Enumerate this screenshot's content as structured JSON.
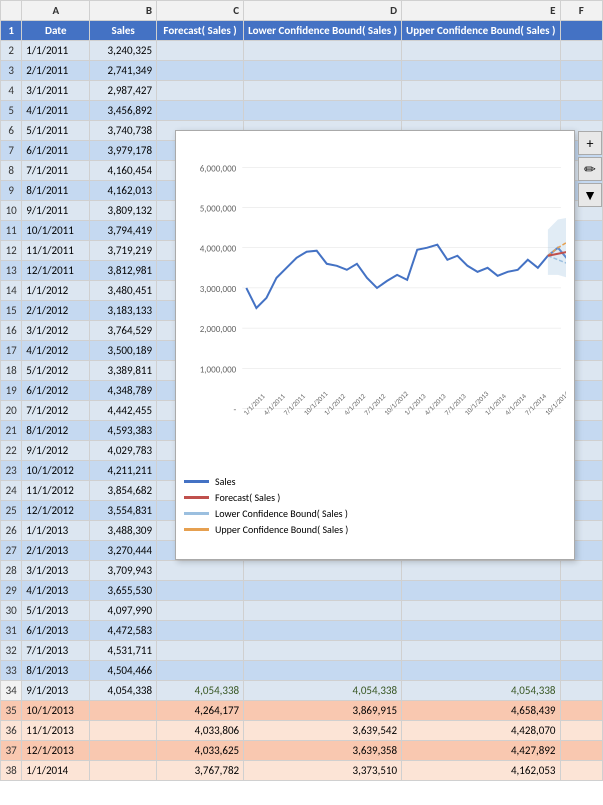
{
  "columns": {
    "rowHeader": "",
    "A": "A",
    "B": "B",
    "C": "C",
    "D": "D",
    "E": "E",
    "F": "F"
  },
  "headers": {
    "row": 1,
    "A": "Date",
    "B": "Sales",
    "C": "Forecast( Sales )",
    "D": "Lower Confidence Bound( Sales )",
    "E": "Upper Confidence Bound( Sales )",
    "F": ""
  },
  "rows": [
    {
      "row": 2,
      "A": "1/1/2011",
      "B": "3,240,325",
      "C": "",
      "D": "",
      "E": "",
      "F": ""
    },
    {
      "row": 3,
      "A": "2/1/2011",
      "B": "2,741,349",
      "C": "",
      "D": "",
      "E": "",
      "F": ""
    },
    {
      "row": 4,
      "A": "3/1/2011",
      "B": "2,987,427",
      "C": "",
      "D": "",
      "E": "",
      "F": ""
    },
    {
      "row": 5,
      "A": "4/1/2011",
      "B": "3,456,892",
      "C": "",
      "D": "",
      "E": "",
      "F": ""
    },
    {
      "row": 6,
      "A": "5/1/2011",
      "B": "3,740,738",
      "C": "",
      "D": "",
      "E": "",
      "F": ""
    },
    {
      "row": 7,
      "A": "6/1/2011",
      "B": "3,979,178",
      "C": "",
      "D": "",
      "E": "",
      "F": ""
    },
    {
      "row": 8,
      "A": "7/1/2011",
      "B": "4,160,454",
      "C": "",
      "D": "",
      "E": "",
      "F": ""
    },
    {
      "row": 9,
      "A": "8/1/2011",
      "B": "4,162,013",
      "C": "",
      "D": "",
      "E": "",
      "F": ""
    },
    {
      "row": 10,
      "A": "9/1/2011",
      "B": "3,809,132",
      "C": "",
      "D": "",
      "E": "",
      "F": ""
    },
    {
      "row": 11,
      "A": "10/1/2011",
      "B": "3,794,419",
      "C": "",
      "D": "",
      "E": "",
      "F": ""
    },
    {
      "row": 12,
      "A": "11/1/2011",
      "B": "3,719,219",
      "C": "",
      "D": "",
      "E": "",
      "F": ""
    },
    {
      "row": 13,
      "A": "12/1/2011",
      "B": "3,812,981",
      "C": "",
      "D": "",
      "E": "",
      "F": ""
    },
    {
      "row": 14,
      "A": "1/1/2012",
      "B": "3,480,451",
      "C": "",
      "D": "",
      "E": "",
      "F": ""
    },
    {
      "row": 15,
      "A": "2/1/2012",
      "B": "3,183,133",
      "C": "",
      "D": "",
      "E": "",
      "F": ""
    },
    {
      "row": 16,
      "A": "3/1/2012",
      "B": "3,764,529",
      "C": "",
      "D": "",
      "E": "",
      "F": ""
    },
    {
      "row": 17,
      "A": "4/1/2012",
      "B": "3,500,189",
      "C": "",
      "D": "",
      "E": "",
      "F": ""
    },
    {
      "row": 18,
      "A": "5/1/2012",
      "B": "3,389,811",
      "C": "",
      "D": "",
      "E": "",
      "F": ""
    },
    {
      "row": 19,
      "A": "6/1/2012",
      "B": "4,348,789",
      "C": "",
      "D": "",
      "E": "",
      "F": ""
    },
    {
      "row": 20,
      "A": "7/1/2012",
      "B": "4,442,455",
      "C": "",
      "D": "",
      "E": "",
      "F": ""
    },
    {
      "row": 21,
      "A": "8/1/2012",
      "B": "4,593,383",
      "C": "",
      "D": "",
      "E": "",
      "F": ""
    },
    {
      "row": 22,
      "A": "9/1/2012",
      "B": "4,029,783",
      "C": "",
      "D": "",
      "E": "",
      "F": ""
    },
    {
      "row": 23,
      "A": "10/1/2012",
      "B": "4,211,211",
      "C": "",
      "D": "",
      "E": "",
      "F": ""
    },
    {
      "row": 24,
      "A": "11/1/2012",
      "B": "3,854,682",
      "C": "",
      "D": "",
      "E": "",
      "F": ""
    },
    {
      "row": 25,
      "A": "12/1/2012",
      "B": "3,554,831",
      "C": "",
      "D": "",
      "E": "",
      "F": ""
    },
    {
      "row": 26,
      "A": "1/1/2013",
      "B": "3,488,309",
      "C": "",
      "D": "",
      "E": "",
      "F": ""
    },
    {
      "row": 27,
      "A": "2/1/2013",
      "B": "3,270,444",
      "C": "",
      "D": "",
      "E": "",
      "F": ""
    },
    {
      "row": 28,
      "A": "3/1/2013",
      "B": "3,709,943",
      "C": "",
      "D": "",
      "E": "",
      "F": ""
    },
    {
      "row": 29,
      "A": "4/1/2013",
      "B": "3,655,530",
      "C": "",
      "D": "",
      "E": "",
      "F": ""
    },
    {
      "row": 30,
      "A": "5/1/2013",
      "B": "4,097,990",
      "C": "",
      "D": "",
      "E": "",
      "F": ""
    },
    {
      "row": 31,
      "A": "6/1/2013",
      "B": "4,472,583",
      "C": "",
      "D": "",
      "E": "",
      "F": ""
    },
    {
      "row": 32,
      "A": "7/1/2013",
      "B": "4,531,711",
      "C": "",
      "D": "",
      "E": "",
      "F": ""
    },
    {
      "row": 33,
      "A": "8/1/2013",
      "B": "4,504,466",
      "C": "",
      "D": "",
      "E": "",
      "F": ""
    },
    {
      "row": 34,
      "A": "9/1/2013",
      "B": "4,054,338",
      "C": "4,054,338",
      "D": "4,054,338",
      "E": "4,054,338",
      "F": ""
    },
    {
      "row": 35,
      "A": "10/1/2013",
      "B": "",
      "C": "4,264,177",
      "D": "3,869,915",
      "E": "4,658,439",
      "F": ""
    },
    {
      "row": 36,
      "A": "11/1/2013",
      "B": "",
      "C": "4,033,806",
      "D": "3,639,542",
      "E": "4,428,070",
      "F": ""
    },
    {
      "row": 37,
      "A": "12/1/2013",
      "B": "",
      "C": "4,033,625",
      "D": "3,639,358",
      "E": "4,427,892",
      "F": ""
    },
    {
      "row": 38,
      "A": "1/1/2014",
      "B": "",
      "C": "3,767,782",
      "D": "3,373,510",
      "E": "4,162,053",
      "F": ""
    }
  ],
  "chart": {
    "title": "",
    "legend": [
      {
        "label": "Sales",
        "color": "#4472c4"
      },
      {
        "label": "Forecast( Sales )",
        "color": "#c0504d"
      },
      {
        "label": "Lower Confidence Bound( Sales )",
        "color": "#9bbfdf"
      },
      {
        "label": "Upper Confidence Bound( Sales )",
        "color": "#e6a050"
      }
    ],
    "yAxis": {
      "labels": [
        "6,000,000",
        "5,000,000",
        "4,000,000",
        "3,000,000",
        "2,000,000",
        "1,000,000",
        "-"
      ]
    },
    "toolbar": {
      "add": "+",
      "brush": "✏",
      "filter": "▼"
    }
  }
}
